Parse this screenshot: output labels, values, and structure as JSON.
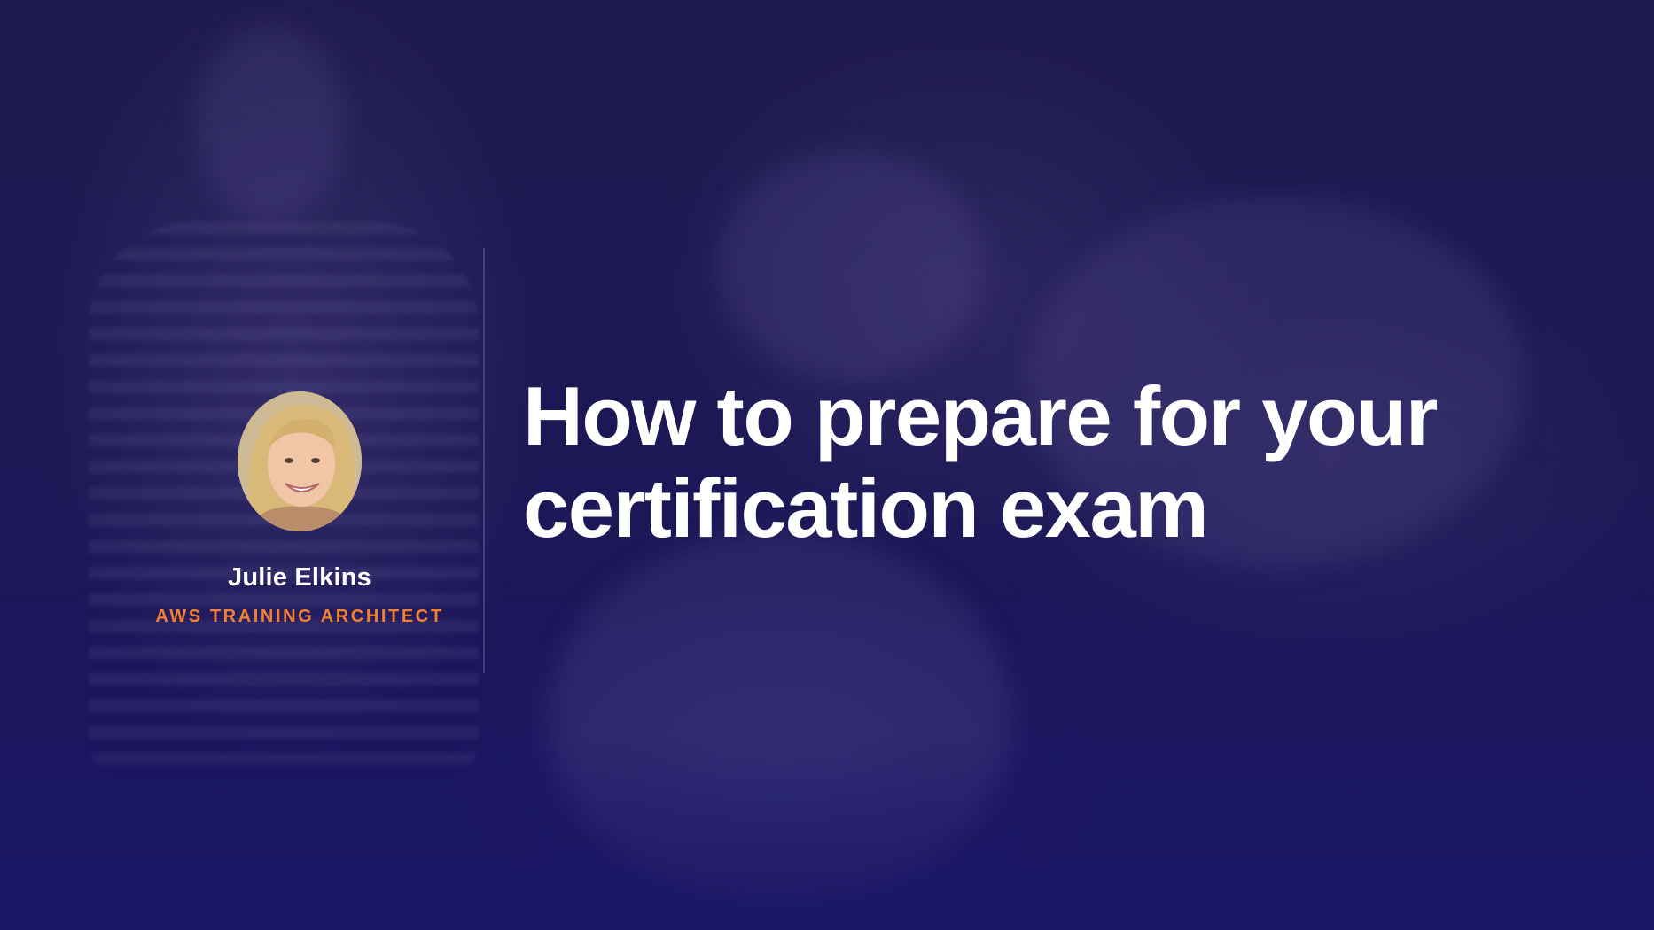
{
  "slide": {
    "title_lines": [
      "How to prepare for your",
      "certification exam"
    ],
    "presenter": {
      "name": "Julie Elkins",
      "role": "AWS TRAINING ARCHITECT"
    }
  },
  "colors": {
    "background": "#1c1756",
    "title": "#ffffff",
    "name": "#ffffff",
    "role_accent": "#f2812f"
  }
}
